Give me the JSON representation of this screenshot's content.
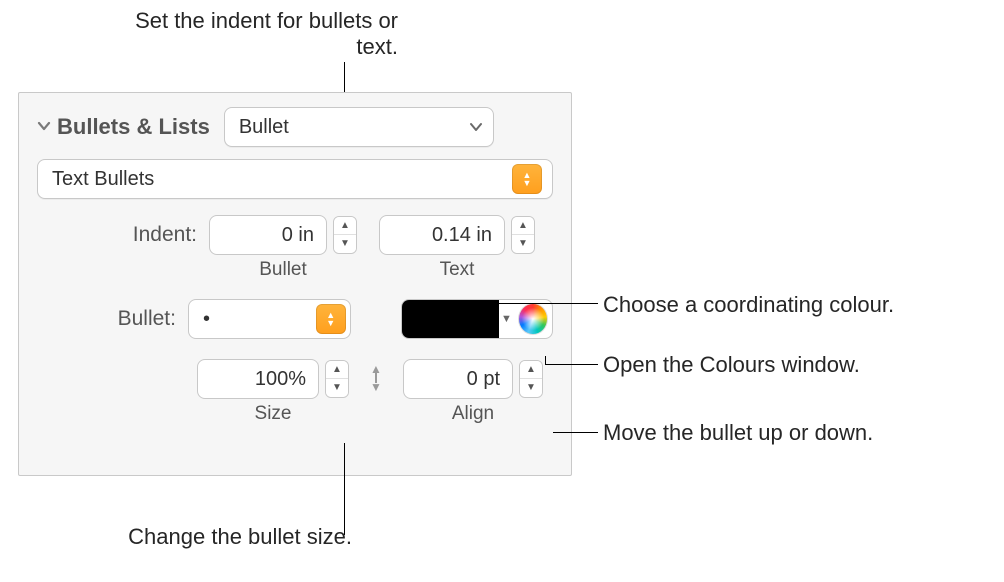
{
  "callouts": {
    "indent": "Set the indent for bullets or text.",
    "coord_colour": "Choose a coordinating colour.",
    "open_colours": "Open the Colours window.",
    "move_bullet": "Move the bullet up or down.",
    "change_size": "Change the bullet size."
  },
  "panel": {
    "section_title": "Bullets & Lists",
    "style_popup": "Bullet",
    "type_popup": "Text Bullets",
    "labels": {
      "indent": "Indent:",
      "bullet": "Bullet:",
      "bullet_sub": "Bullet",
      "text_sub": "Text",
      "size_sub": "Size",
      "align_sub": "Align"
    },
    "fields": {
      "indent_bullet": "0 in",
      "indent_text": "0.14 in",
      "bullet_char": "•",
      "size": "100%",
      "align": "0 pt"
    },
    "color_swatch": "#000000"
  }
}
